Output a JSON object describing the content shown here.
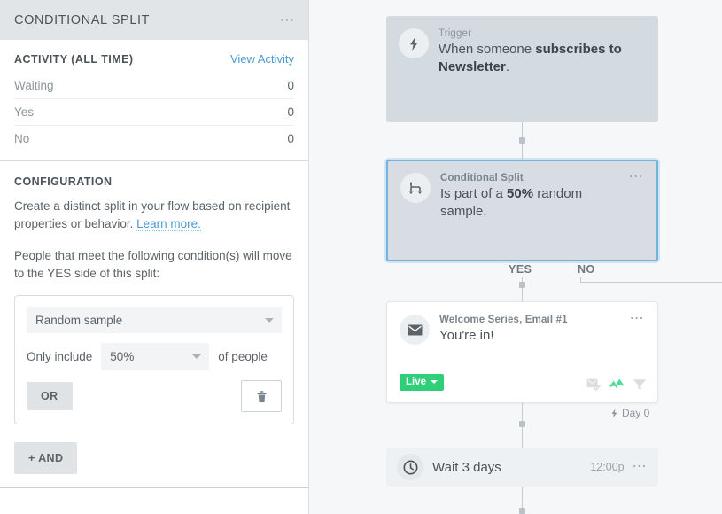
{
  "sidebar": {
    "header": {
      "title": "CONDITIONAL SPLIT",
      "menu_icon": "ellipsis-icon"
    },
    "activity": {
      "title": "ACTIVITY (ALL TIME)",
      "link_label": "View Activity",
      "rows": [
        {
          "label": "Waiting",
          "value": "0"
        },
        {
          "label": "Yes",
          "value": "0"
        },
        {
          "label": "No",
          "value": "0"
        }
      ]
    },
    "configuration": {
      "title": "CONFIGURATION",
      "desc_part1": "Create a distinct split in your flow based on recipient properties or behavior.",
      "desc_link": "Learn more.",
      "desc_part2": "People that meet the following condition(s) will move to the YES side of this split:",
      "condition": {
        "type_value": "Random sample",
        "prefix_label": "Only include",
        "percent_value": "50%",
        "suffix_label": "of people",
        "or_label": "OR",
        "delete_icon": "trash-icon"
      },
      "and_label": "+ AND"
    }
  },
  "canvas": {
    "trigger": {
      "icon": "lightning-bolt-icon",
      "kicker": "Trigger",
      "title_prefix": "When someone ",
      "title_bold": "subscribes to Newsletter",
      "title_suffix": "."
    },
    "split": {
      "icon": "split-branch-icon",
      "kicker": "Conditional Split",
      "title_prefix": "Is part of a ",
      "title_bold": "50%",
      "title_suffix": " random sample.",
      "menu_icon": "ellipsis-icon",
      "branch_yes": "YES",
      "branch_no": "NO"
    },
    "email": {
      "icon": "envelope-icon",
      "kicker": "Welcome Series, Email #1",
      "title": "You're in!",
      "menu_icon": "ellipsis-icon",
      "status_badge": "Live",
      "metric_icons": [
        "envelope-check-icon",
        "analytics-trend-icon",
        "filter-funnel-icon"
      ],
      "day_label": "Day 0"
    },
    "wait": {
      "icon": "clock-icon",
      "title": "Wait 3 days",
      "time": "12:00p",
      "menu_icon": "ellipsis-icon"
    },
    "colors": {
      "accent_link": "#4a9ad4",
      "selected_border": "#72b4de",
      "status_live": "#2fcf79",
      "canvas_bg": "#f5f7f8",
      "node_muted_bg": "#d3dae0"
    }
  }
}
